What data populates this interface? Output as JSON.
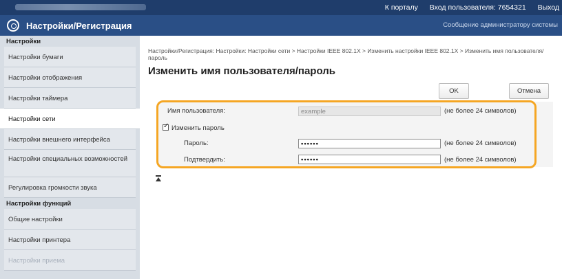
{
  "topbar": {
    "portal_link": "К порталу",
    "login_user": "Вход пользователя: 7654321",
    "logout": "Выход"
  },
  "header": {
    "title": "Настройки/Регистрация",
    "admin_message": "Сообщение администратору системы"
  },
  "sidebar": {
    "group1": "Настройки",
    "items1": [
      "Настройки бумаги",
      "Настройки отображения",
      "Настройки таймера",
      "Настройки сети",
      "Настройки внешнего интерфейса",
      "Настройки специальных возможностей",
      "Регулировка громкости звука"
    ],
    "group2": "Настройки функций",
    "items2": [
      "Общие настройки",
      "Настройки принтера",
      "Настройки приема"
    ]
  },
  "main": {
    "breadcrumb": "Настройки/Регистрация: Настройки: Настройки сети > Настройки IEEE 802.1X > Изменить настройки IEEE 802.1X > Изменить имя пользователя/пароль",
    "title": "Изменить имя пользователя/пароль",
    "ok_label": "OK",
    "cancel_label": "Отмена",
    "username_label": "Имя пользователя:",
    "username_value": "example",
    "username_hint": "(не более 24 символов)",
    "change_password_label": "Изменить пароль",
    "change_password_checked": true,
    "password_label": "Пароль:",
    "password_value": "••••••",
    "password_hint": "(не более 24 символов)",
    "confirm_label": "Подтвердить:",
    "confirm_value": "••••••",
    "confirm_hint": "(не более 24 символов)"
  }
}
